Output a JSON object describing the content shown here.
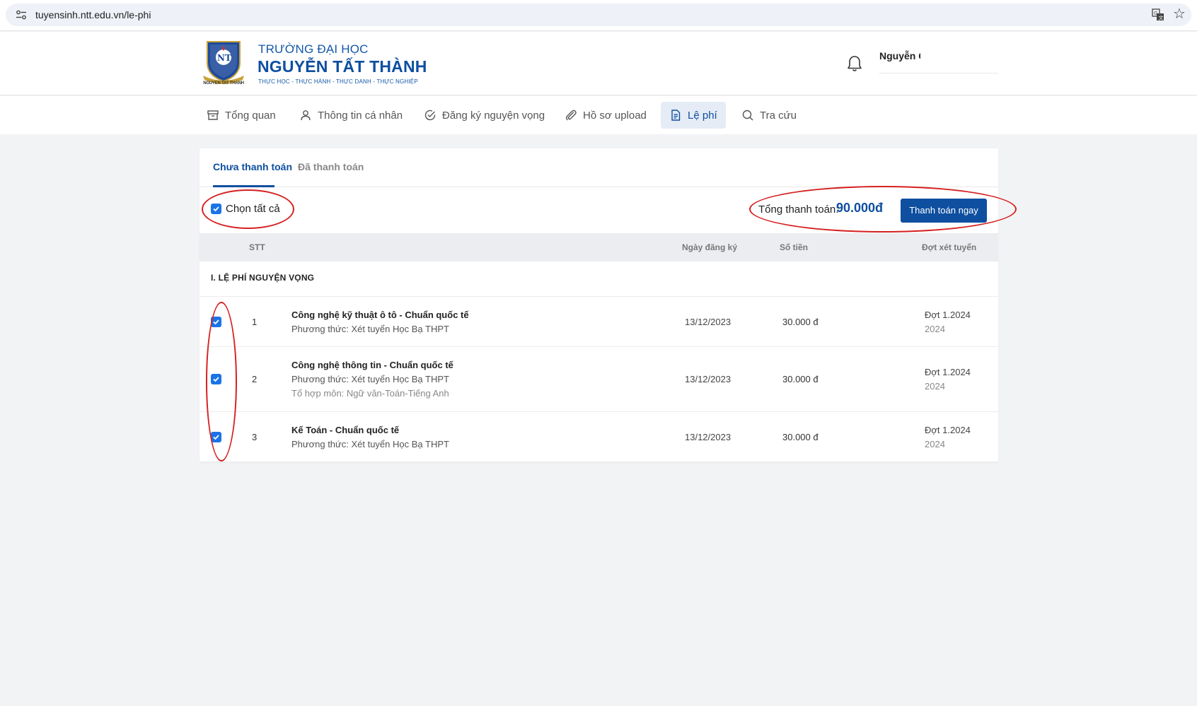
{
  "browser": {
    "url": "tuyensinh.ntt.edu.vn/le-phi"
  },
  "header": {
    "logo_caption": "NGUYEN TAT THANH",
    "brand_line1": "TRƯỜNG ĐẠI HỌC",
    "brand_line2": "NGUYỄN TẤT THÀNH",
    "slogan": "THỰC HỌC - THỰC HÀNH - THỰC DANH - THỰC NGHIỆP",
    "user_name": "Nguyễn C"
  },
  "nav": {
    "items": [
      {
        "label": "Tổng quan",
        "icon": "archive-icon"
      },
      {
        "label": "Thông tin cá nhân",
        "icon": "user-icon"
      },
      {
        "label": "Đăng ký nguyện vọng",
        "icon": "check-circle-icon"
      },
      {
        "label": "Hồ sơ upload",
        "icon": "paperclip-icon"
      },
      {
        "label": "Lệ phí",
        "icon": "document-icon"
      },
      {
        "label": "Tra cứu",
        "icon": "search-icon"
      }
    ],
    "active": "Lệ phí"
  },
  "tabs": {
    "unpaid": "Chưa thanh toán",
    "paid": "Đã thanh toán",
    "active": "Chưa thanh toán"
  },
  "toolbar": {
    "select_all_label": "Chọn tất cả",
    "select_all_checked": true,
    "total_label": "Tổng thanh toán:",
    "total_value": "90.000đ",
    "pay_button_label": "Thanh toán ngay"
  },
  "table": {
    "headers": {
      "stt": "STT",
      "date": "Ngày đăng ký",
      "amount": "Số tiền",
      "round": "Đợt xét tuyển"
    },
    "section_title": "I. LỆ PHÍ NGUYỆN VỌNG",
    "rows": [
      {
        "checked": true,
        "stt": "1",
        "course": "Công nghệ kỹ thuật ô tô - Chuẩn quốc tế",
        "method": "Phương thức: Xét tuyển Học Bạ THPT",
        "combo": "",
        "date": "13/12/2023",
        "amount": "30.000 đ",
        "round": "Đợt 1.2024",
        "year": "2024"
      },
      {
        "checked": true,
        "stt": "2",
        "course": "Công nghệ thông tin - Chuẩn quốc tế",
        "method": "Phương thức: Xét tuyển Học Bạ THPT",
        "combo": "Tổ hợp môn: Ngữ văn-Toán-Tiếng Anh",
        "date": "13/12/2023",
        "amount": "30.000 đ",
        "round": "Đợt 1.2024",
        "year": "2024"
      },
      {
        "checked": true,
        "stt": "3",
        "course": "Kế Toán - Chuẩn quốc tế",
        "method": "Phương thức: Xét tuyển Học Bạ THPT",
        "combo": "",
        "date": "13/12/2023",
        "amount": "30.000 đ",
        "round": "Đợt 1.2024",
        "year": "2024"
      }
    ]
  },
  "colors": {
    "brand": "#0e4fa0",
    "checkbox": "#1a73e8",
    "annotation": "#d62020"
  }
}
